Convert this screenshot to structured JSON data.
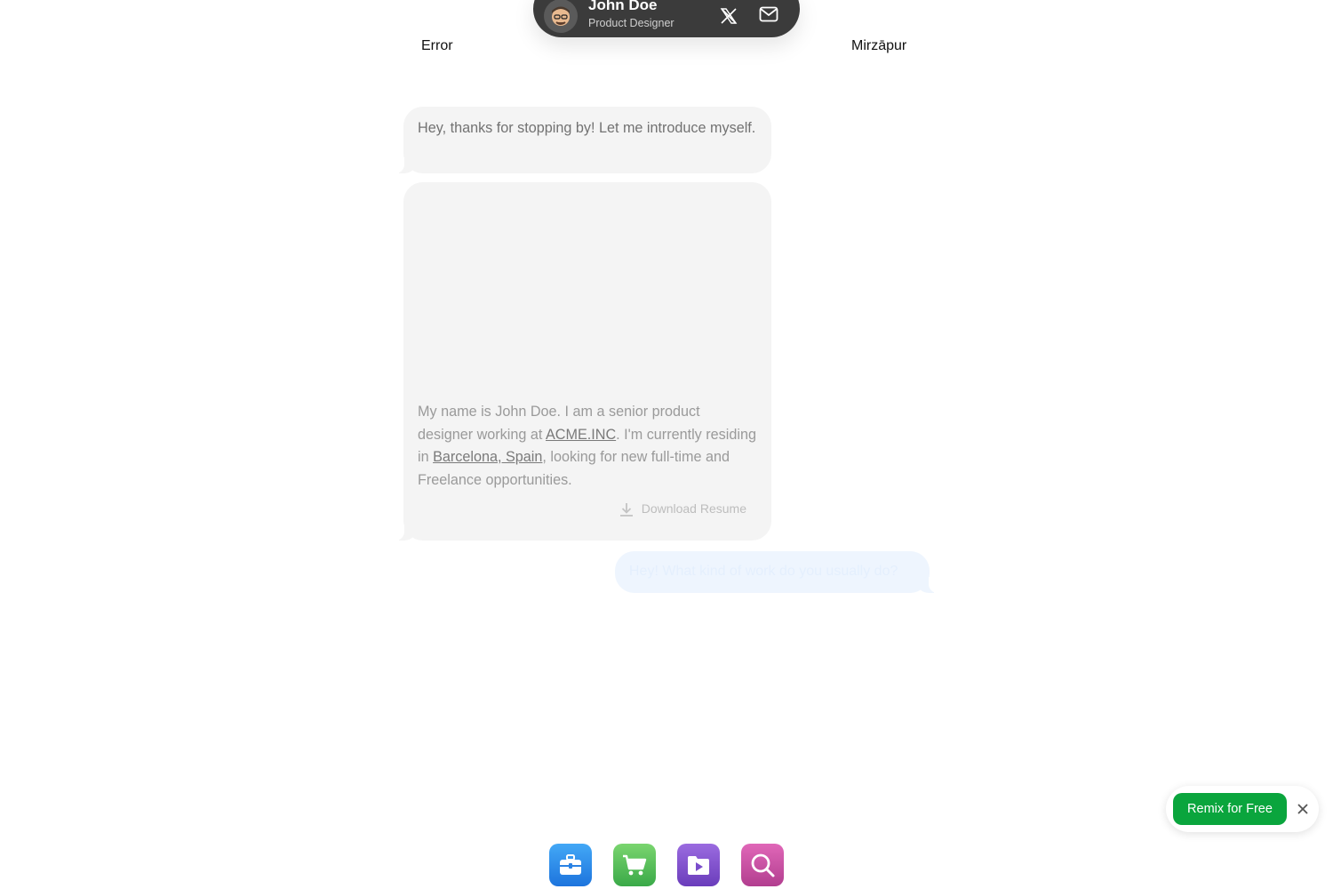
{
  "profile": {
    "name": "John Doe",
    "role": "Product Designer",
    "avatar_icon": "memoji-avatar",
    "links": [
      {
        "icon": "x-twitter-icon"
      },
      {
        "icon": "mail-icon"
      }
    ]
  },
  "labels": {
    "error": "Error",
    "location": "Mirzāpur"
  },
  "chat": {
    "greeting": "Hey, thanks for stopping by! Let me introduce myself.",
    "intro": {
      "before_company": "My name is John Doe. I am a senior product designer working at ",
      "company": "ACME.INC",
      "before_city": ". I'm currently residing in ",
      "city": "Barcelona, Spain",
      "after_city": ", looking for new full-time and Freelance opportunities."
    },
    "download_label": "Download Resume",
    "user_question": "Hey! What kind of work do you usually do?"
  },
  "remix": {
    "button_label": "Remix for Free",
    "close_icon": "close-icon"
  },
  "dock": [
    {
      "icon": "briefcase-icon",
      "color": "#1d74dd"
    },
    {
      "icon": "shopping-cart-icon",
      "color": "#3aa948"
    },
    {
      "icon": "play-folder-icon",
      "color": "#6a3dbb"
    },
    {
      "icon": "search-icon",
      "color": "#b23e8f"
    }
  ]
}
